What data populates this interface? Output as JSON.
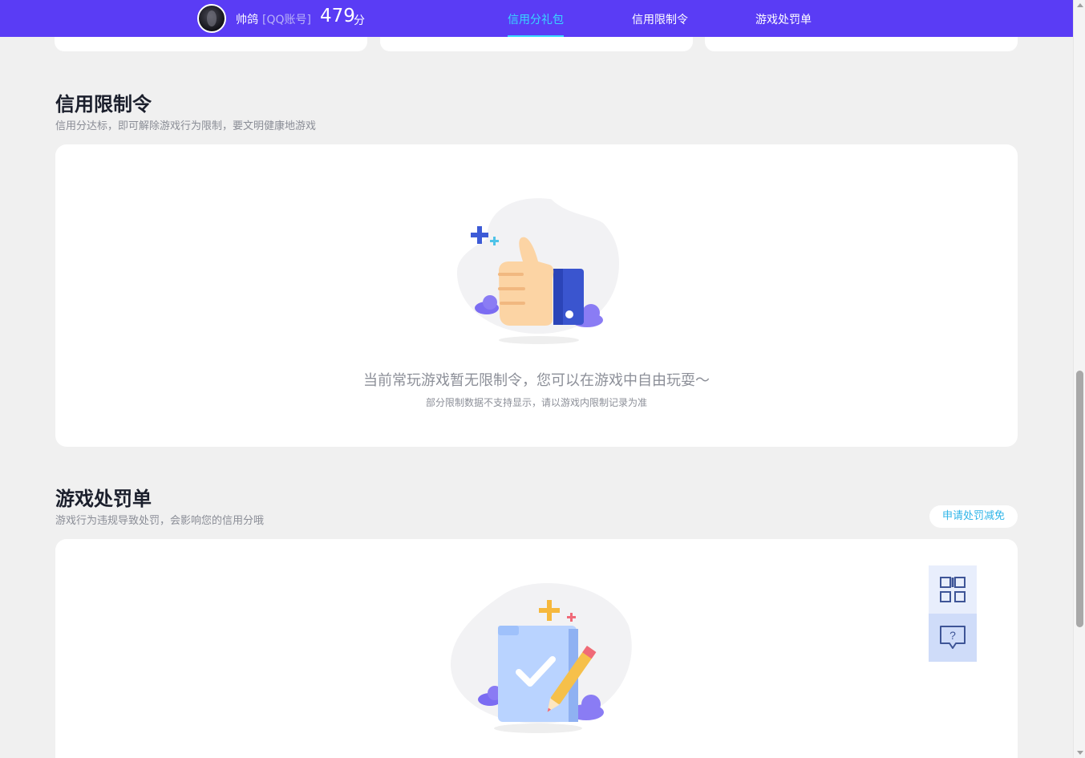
{
  "header": {
    "nickname": "帅鸽",
    "account_type": "[QQ账号]",
    "score": "479",
    "score_unit": "分",
    "tabs": [
      {
        "label": "信用分礼包",
        "active": true
      },
      {
        "label": "信用限制令",
        "active": false
      },
      {
        "label": "游戏处罚单",
        "active": false
      }
    ]
  },
  "restriction": {
    "title": "信用限制令",
    "subtitle": "信用分达标，即可解除游戏行为限制，要文明健康地游戏",
    "empty_text": "当前常玩游戏暂无限制令，您可以在游戏中自由玩耍～",
    "empty_note": "部分限制数据不支持显示，请以游戏内限制记录为准",
    "illustration_icon": "thumbs-up-illustration"
  },
  "punishment": {
    "title": "游戏处罚单",
    "subtitle": "游戏行为违规导致处罚，会影响您的信用分哦",
    "apply_button": "申请处罚减免",
    "illustration_icon": "document-check-illustration"
  },
  "float_tools": {
    "qr_icon": "qr-code-icon",
    "help_icon": "help-bubble-icon"
  },
  "colors": {
    "header_bg": "#5a3cf5",
    "active_tab": "#37d8ff",
    "apply_text": "#2fb5e8"
  }
}
